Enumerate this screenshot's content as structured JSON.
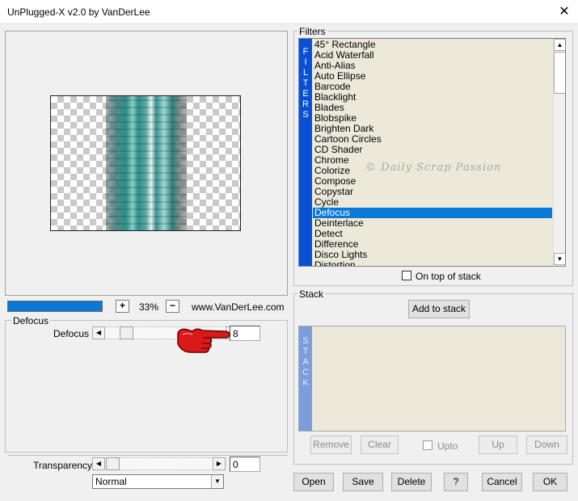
{
  "window": {
    "title": "UnPlugged-X v2.0 by VanDerLee",
    "close_glyph": "✕"
  },
  "preview": {
    "zoom_value": "33%",
    "zoom_plus": "+",
    "zoom_minus": "−",
    "website": "www.VanDerLee.com"
  },
  "defocus_group": {
    "title": "Defocus",
    "param_label": "Defocus",
    "param_value": "8"
  },
  "blend": {
    "transparency_label": "Transparency",
    "transparency_value": "0",
    "mode": "Normal"
  },
  "filters": {
    "title": "Filters",
    "vertical_label": "FILTERS",
    "items": [
      "45° Rectangle",
      "Acid Waterfall",
      "Anti-Alias",
      "Auto Ellipse",
      "Barcode",
      "Blacklight",
      "Blades",
      "Blobspike",
      "Brighten Dark",
      "Cartoon Circles",
      "CD Shader",
      "Chrome",
      "Colorize",
      "Compose",
      "Copystar",
      "Cycle",
      "Defocus",
      "Deinterlace",
      "Detect",
      "Difference",
      "Disco Lights",
      "Distortion"
    ],
    "selected": "Defocus",
    "on_top_label": "On top of stack",
    "watermark": "© Daily Scrap Passion"
  },
  "stack": {
    "title": "Stack",
    "vertical_label": "STACK",
    "add_label": "Add to stack",
    "remove_label": "Remove",
    "clear_label": "Clear",
    "upto_label": "Upto",
    "up_label": "Up",
    "down_label": "Down"
  },
  "footer": {
    "open": "Open",
    "save": "Save",
    "delete": "Delete",
    "help": "?",
    "cancel": "Cancel",
    "ok": "OK"
  },
  "icons": {
    "arrow_left": "◀",
    "arrow_right": "▶",
    "arrow_up": "▲",
    "arrow_down": "▼",
    "pointer": "pointing-hand-icon"
  },
  "colors": {
    "accent": "#0a78d7",
    "filters_bar": "#0a50d4",
    "stack_bar": "#7c9ddb",
    "list_bg": "#ece9da",
    "hand_red": "#d81a1a"
  }
}
